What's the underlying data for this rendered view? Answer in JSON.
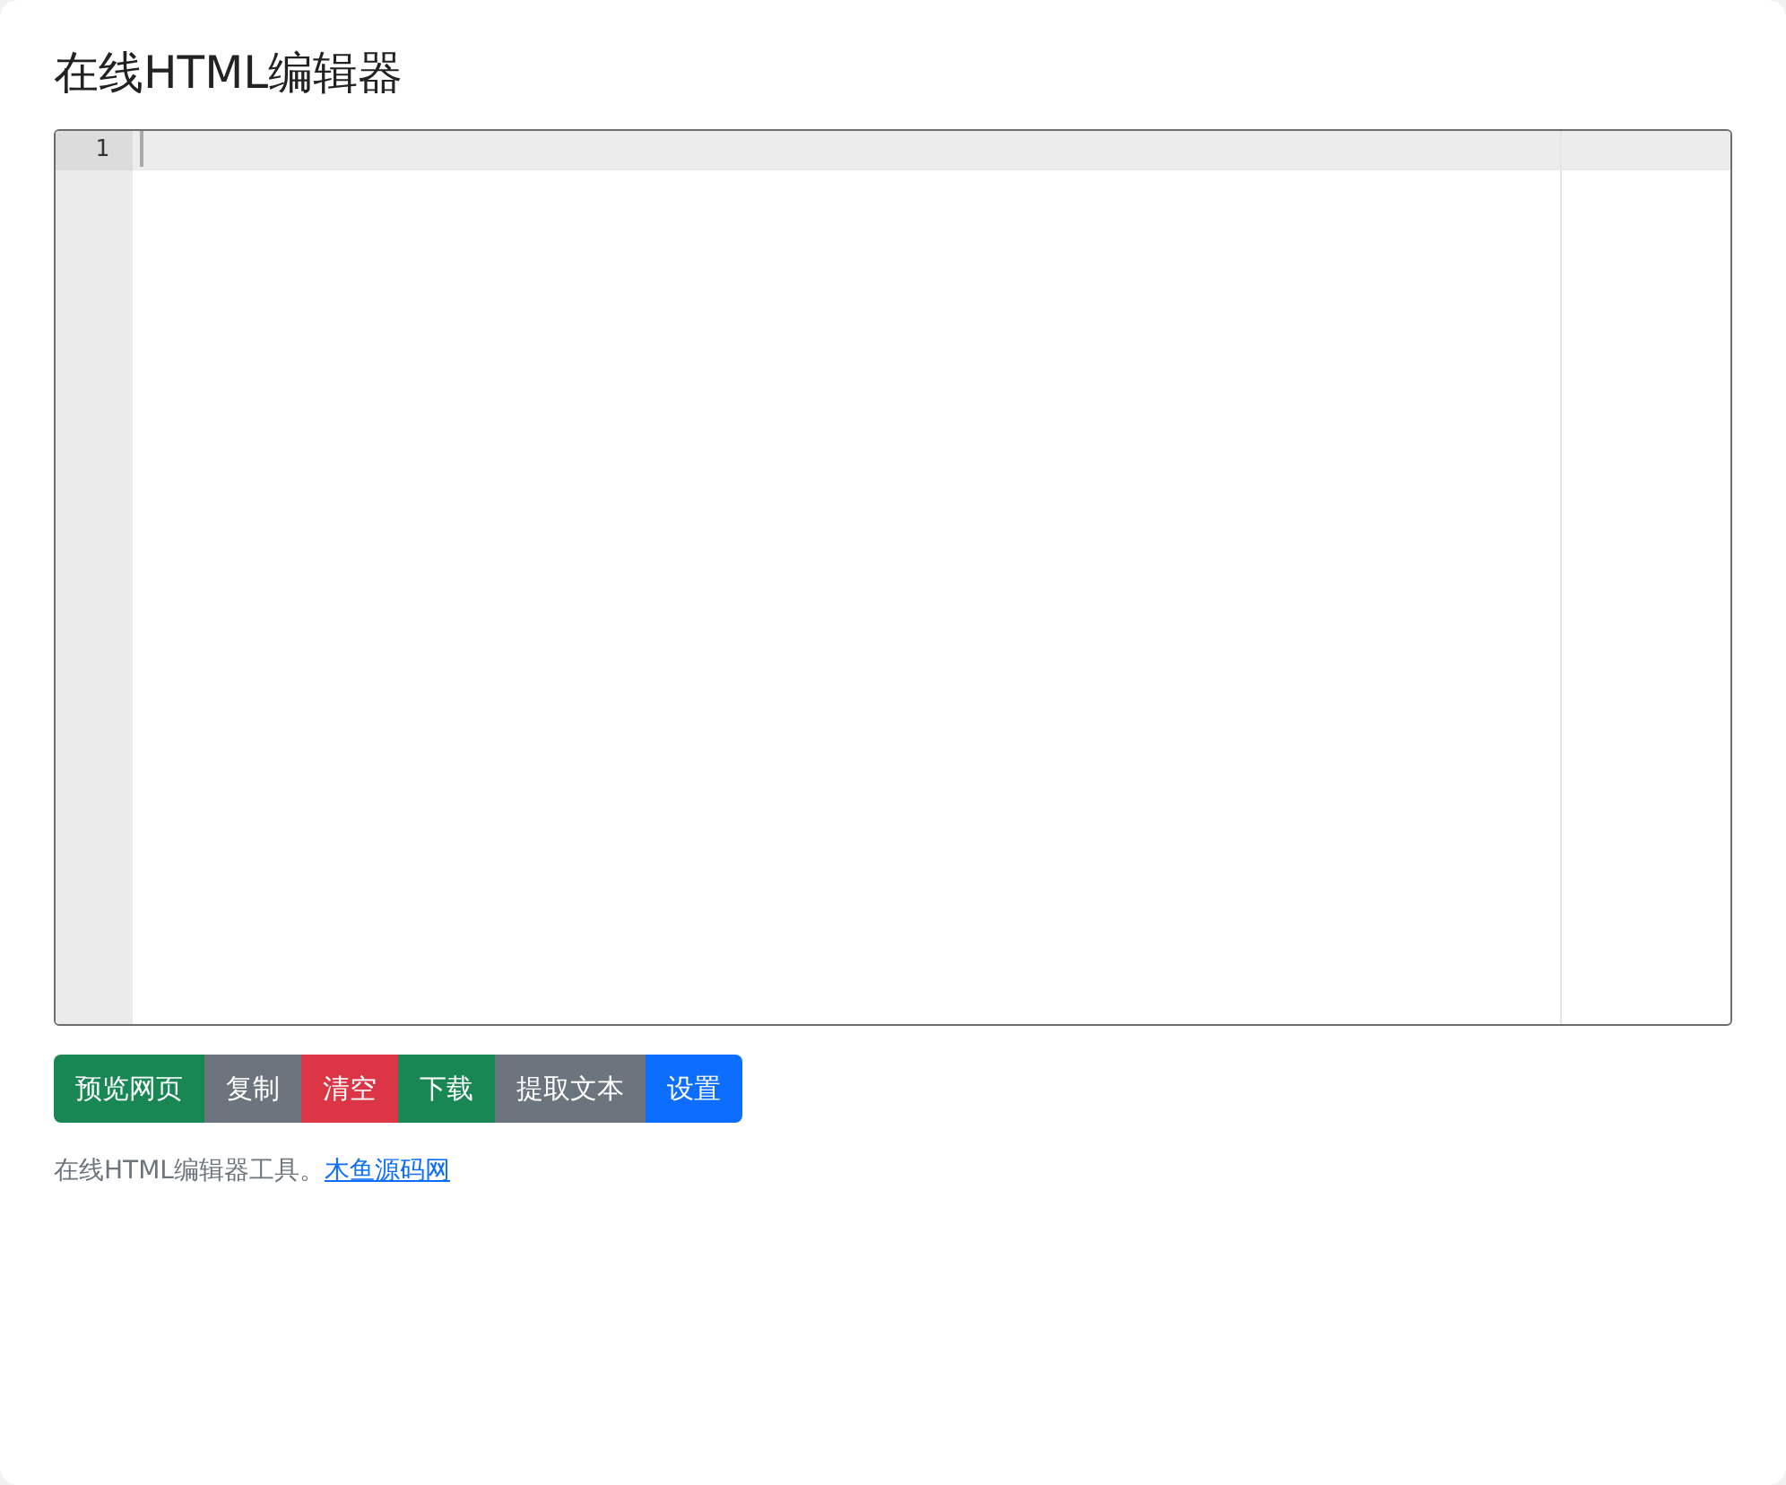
{
  "title": "在线HTML编辑器",
  "editor": {
    "line_numbers": [
      "1"
    ]
  },
  "buttons": [
    {
      "label": "预览网页",
      "kind": "success"
    },
    {
      "label": "复制",
      "kind": "secondary"
    },
    {
      "label": "清空",
      "kind": "danger"
    },
    {
      "label": "下载",
      "kind": "success"
    },
    {
      "label": "提取文本",
      "kind": "secondary"
    },
    {
      "label": "设置",
      "kind": "primary"
    }
  ],
  "footer": {
    "text": "在线HTML编辑器工具。",
    "link": "木鱼源码网"
  }
}
